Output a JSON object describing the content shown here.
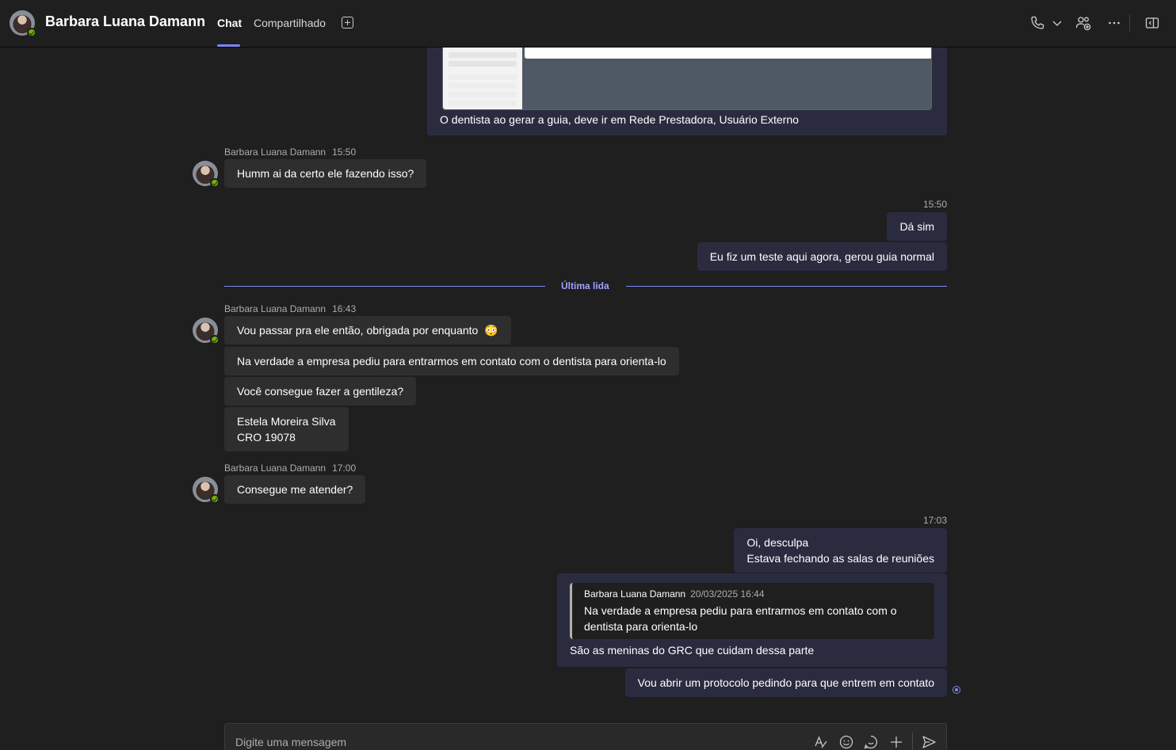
{
  "header": {
    "title": "Barbara Luana Damann",
    "tabs": [
      {
        "label": "Chat",
        "active": true
      },
      {
        "label": "Compartilhado",
        "active": false
      }
    ],
    "icons": [
      "phone-icon",
      "chevron-down-icon",
      "people-add-icon",
      "more-icon",
      "open-side-panel-icon"
    ]
  },
  "messages": {
    "image_card": {
      "caption": "O dentista ao gerar a guia, deve ir em Rede Prestadora, Usuário Externo"
    },
    "group1": {
      "sender": "Barbara Luana Damann",
      "time": "15:50",
      "items": [
        "Humm ai da certo ele fazendo isso?"
      ]
    },
    "out1": {
      "time": "15:50",
      "items": [
        "Dá sim",
        "Eu fiz um teste aqui agora, gerou guia normal"
      ]
    },
    "last_read": "Última lida",
    "group2": {
      "sender": "Barbara Luana Damann",
      "time": "16:43",
      "items": [
        "Vou passar pra ele então, obrigada por enquanto",
        "Na verdade a empresa pediu para entrarmos em contato com o dentista para orienta-lo",
        "Você consegue fazer a gentileza?",
        "Estela Moreira Silva",
        "CRO 19078"
      ],
      "emoji": "😳"
    },
    "group3": {
      "sender": "Barbara Luana Damann",
      "time": "17:00",
      "items": [
        "Consegue me atender?"
      ]
    },
    "out2": {
      "time": "17:03",
      "line1": "Oi, desculpa",
      "line2": "Estava fechando as salas de reuniões",
      "quote": {
        "name": "Barbara Luana Damann",
        "date": "20/03/2025 16:44",
        "text": "Na verdade a empresa pediu para entrarmos em contato com o dentista para orienta-lo"
      },
      "reply": "São as meninas do GRC que cuidam dessa parte",
      "last": "Vou abrir um protocolo pedindo para que entrem em contato"
    }
  },
  "composer": {
    "placeholder": "Digite uma mensagem",
    "icons": [
      "format-icon",
      "emoji-icon",
      "sticker-icon",
      "add-icon",
      "send-icon"
    ]
  },
  "colors": {
    "background": "#1f1f1f",
    "outgoing_bubble": "#2b2b40",
    "incoming_bubble": "#2e2e2e",
    "accent": "#7f85f5",
    "presence": "#6bb700"
  }
}
